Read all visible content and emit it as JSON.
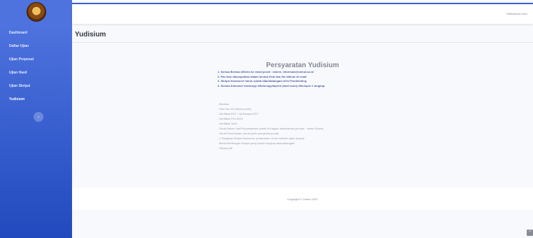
{
  "sidebar": {
    "items": [
      {
        "label": "Dashboard"
      },
      {
        "label": "Daftar Ujian"
      },
      {
        "label": "Ujian Proposal"
      },
      {
        "label": "Ujian Hasil"
      },
      {
        "label": "Ujian Skripsi"
      },
      {
        "label": "Yudisium"
      }
    ],
    "toggle_glyph": "‹"
  },
  "topbar": {
    "user_name": "Mahasiswa User"
  },
  "page": {
    "title": "Yudisium"
  },
  "requirements": {
    "heading": "Persyaratan Yudisium",
    "rules": [
      "1. Semua Berkas diKirim ke email prodi : sistem_informasi@unmul.ac.id",
      "2. Pas foto dikumpulkan dalam bentuk fisik dan file dikirim di email",
      "3. Skripsi hardcover harus sudah ditandatangani oleh Pembimbing",
      "4. Semua Dokumen hardcopy difotocopy/diprint (hasil scan) dikumpul 1 rangkap"
    ],
    "documents": [
      "- Biodata",
      "- Pas foto 3x4 (hitam putih)",
      "- Sertifikat EST / Uji Bahasa EST",
      "- Sertifikat PKL/KKN",
      "- Sertifikat Toefl",
      "- Surat Bebas Lab/Perpustakaan (ambil di bagian administrasi jurusan - minta Dosen)",
      "- Surat Penerimaan Jurnal (oleh pengelola jurnal)",
      "- 1 Rangkap Skripsi hardcover (maksimum 3 hari setelah ujian skripsi)",
      "- Berita Bimbingan Skripsi yang sudah lengkap ditandatangani",
      "- Skripsi pdf"
    ]
  },
  "footer": {
    "copyright": "Copyright © Unmul 2021"
  },
  "scroll_top": {
    "glyph": "^"
  },
  "colors": {
    "sidebar_start": "#4e73df",
    "sidebar_end": "#224abe",
    "page_bg": "#f8f9fc",
    "rule_text": "#4e5da0"
  }
}
